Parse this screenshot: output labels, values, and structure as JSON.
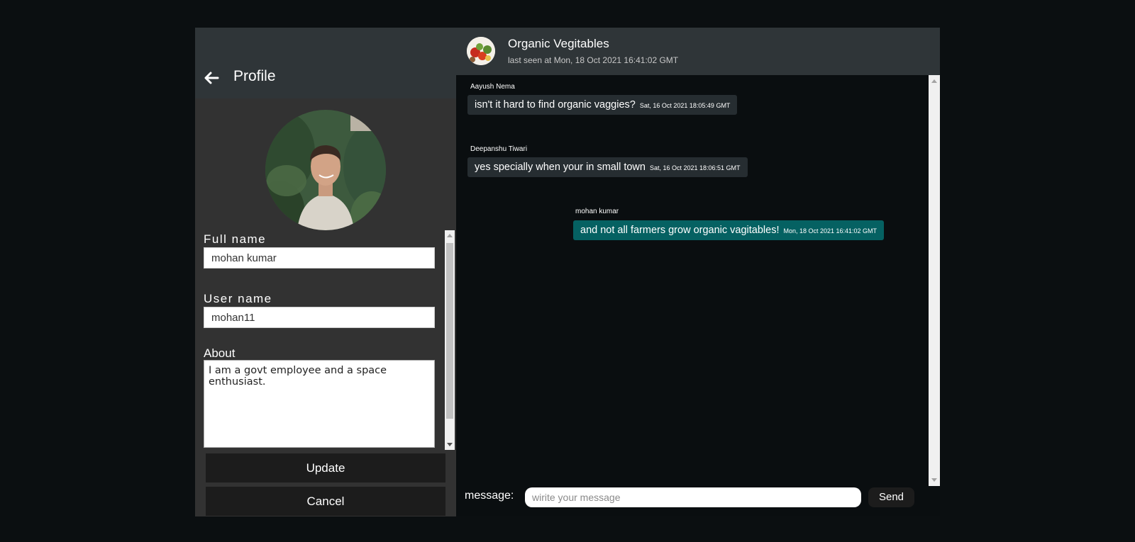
{
  "profile": {
    "back_icon": "arrow-left-icon",
    "title": "Profile",
    "avatar_icon": "user-avatar-photo",
    "full_name_label": "Full name",
    "full_name_value": "mohan kumar",
    "user_name_label": "User name",
    "user_name_value": "mohan11",
    "about_label": "About",
    "about_value": "I am a govt employee and a space enthusiast.",
    "update_label": "Update",
    "cancel_label": "Cancel"
  },
  "chat": {
    "group_name": "Organic Vegitables",
    "group_status": "last seen at Mon, 18 Oct 2021 16:41:02 GMT",
    "group_avatar_icon": "vegetables-photo",
    "messages": [
      {
        "sender": "Aayush Nema",
        "text": "isn't it hard to find organic vaggies?",
        "time": "Sat, 16 Oct 2021 18:05:49 GMT",
        "mine": false
      },
      {
        "sender": "Deepanshu Tiwari",
        "text": "yes specially when your in small town",
        "time": "Sat, 16 Oct 2021 18:06:51 GMT",
        "mine": false
      },
      {
        "sender": "mohan kumar",
        "text": "and not all farmers grow organic vagitables!",
        "time": "Mon, 18 Oct 2021 16:41:02 GMT",
        "mine": true
      }
    ]
  },
  "composer": {
    "label": "message:",
    "placeholder": "wirite your message",
    "send_label": "Send"
  },
  "colors": {
    "background": "#0b0f11",
    "header": "#2f3538",
    "panel": "#323232",
    "bubble_other": "#262d31",
    "bubble_mine": "#056162",
    "button": "#1c1c1c"
  }
}
